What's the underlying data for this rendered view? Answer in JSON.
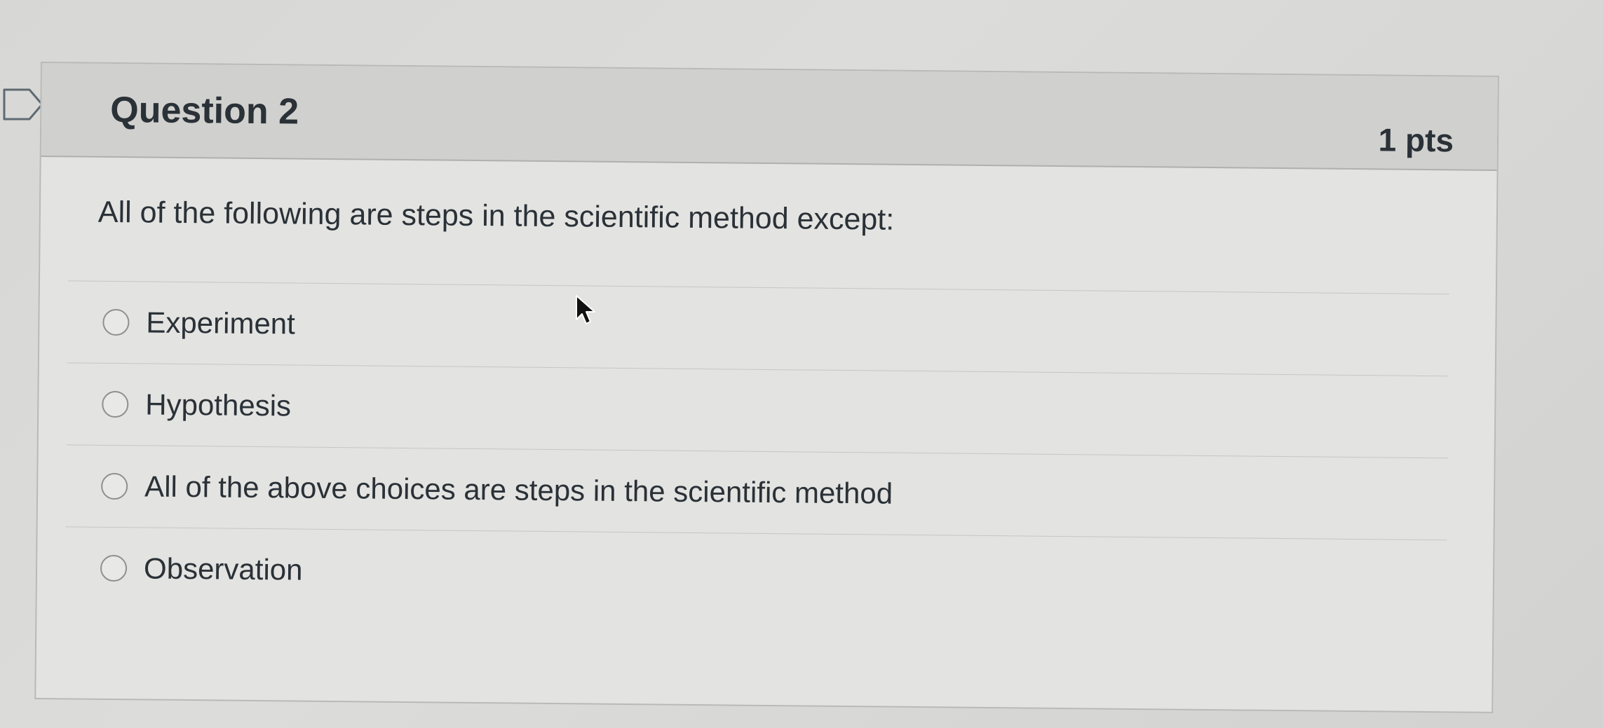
{
  "question": {
    "title": "Question 2",
    "points": "1 pts",
    "prompt": "All of the following are steps in the scientific method except:",
    "answers": [
      {
        "label": "Experiment"
      },
      {
        "label": "Hypothesis"
      },
      {
        "label": "All of the above choices are steps in the scientific method"
      },
      {
        "label": "Observation"
      }
    ]
  },
  "icons": {
    "flag": "flag-icon",
    "cursor": "mouse-pointer-icon"
  }
}
